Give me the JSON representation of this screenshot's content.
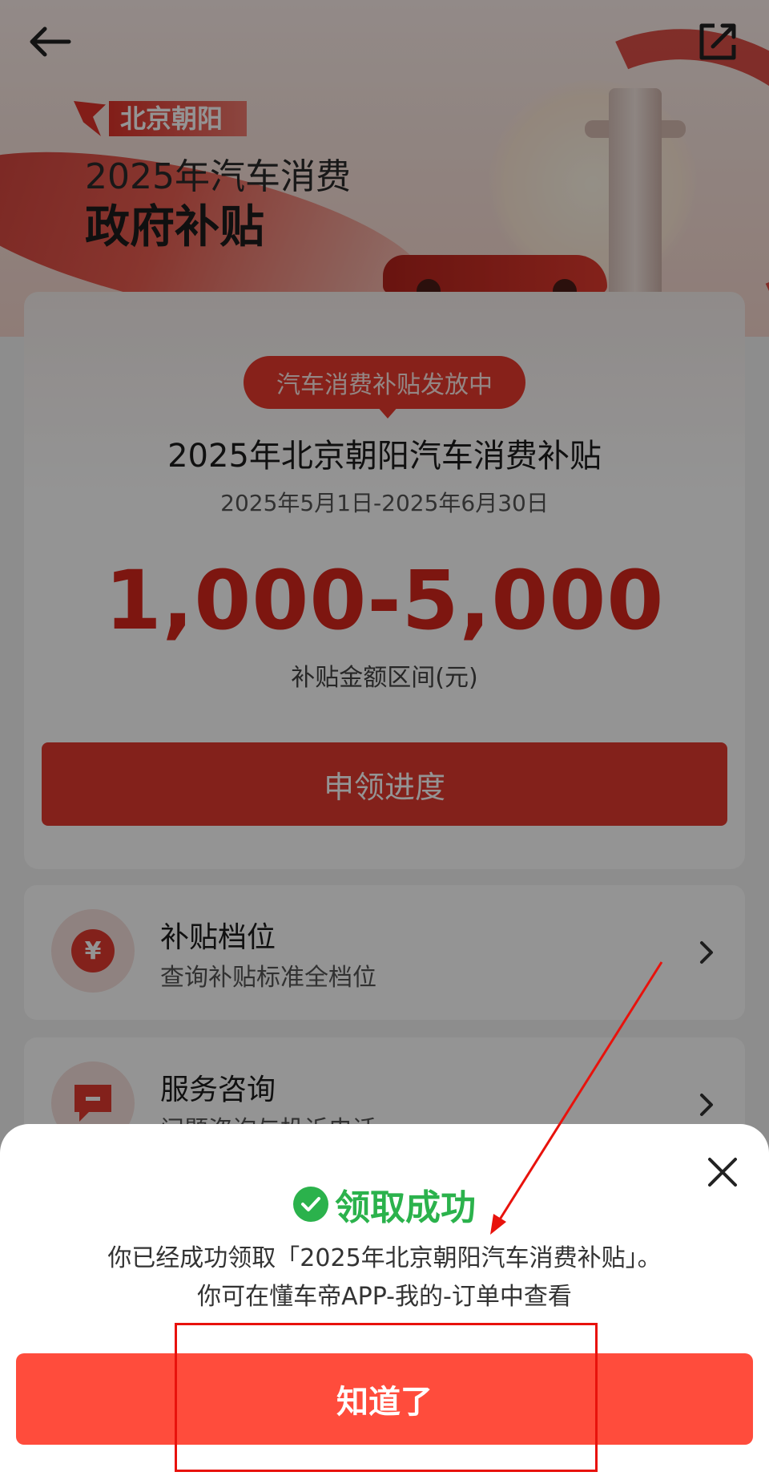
{
  "header": {
    "back_icon": "arrow-left-icon",
    "share_icon": "share-external-icon",
    "tag": "北京朝阳",
    "hero_line1": "2025年汽车消费",
    "hero_line2": "政府补贴"
  },
  "program": {
    "status_pill": "汽车消费补贴发放中",
    "title": "2025年北京朝阳汽车消费补贴",
    "dates": "2025年5月1日-2025年6月30日",
    "amount": "1,000-5,000",
    "amount_label": "补贴金额区间(元)",
    "progress_button": "申领进度"
  },
  "list": [
    {
      "title": "补贴档位",
      "subtitle": "查询补贴标准全档位",
      "icon": "yuan-icon",
      "icon_glyph": "¥"
    },
    {
      "title": "服务咨询",
      "subtitle": "问题咨询与投诉电话",
      "icon": "chat-bubble-icon"
    }
  ],
  "dialog": {
    "success_title": "领取成功",
    "message_line1": "你已经成功领取「2025年北京朝阳汽车消费补贴」。",
    "message_line2": "你可在懂车帝APP-我的-订单中查看",
    "ok_button": "知道了",
    "close_icon": "close-icon",
    "check_icon": "check-circle-icon"
  },
  "colors": {
    "brand_red": "#e23a2f",
    "button_red": "#ff4c3c",
    "success_green": "#2bb24c",
    "annotation_red": "#e8120c"
  }
}
